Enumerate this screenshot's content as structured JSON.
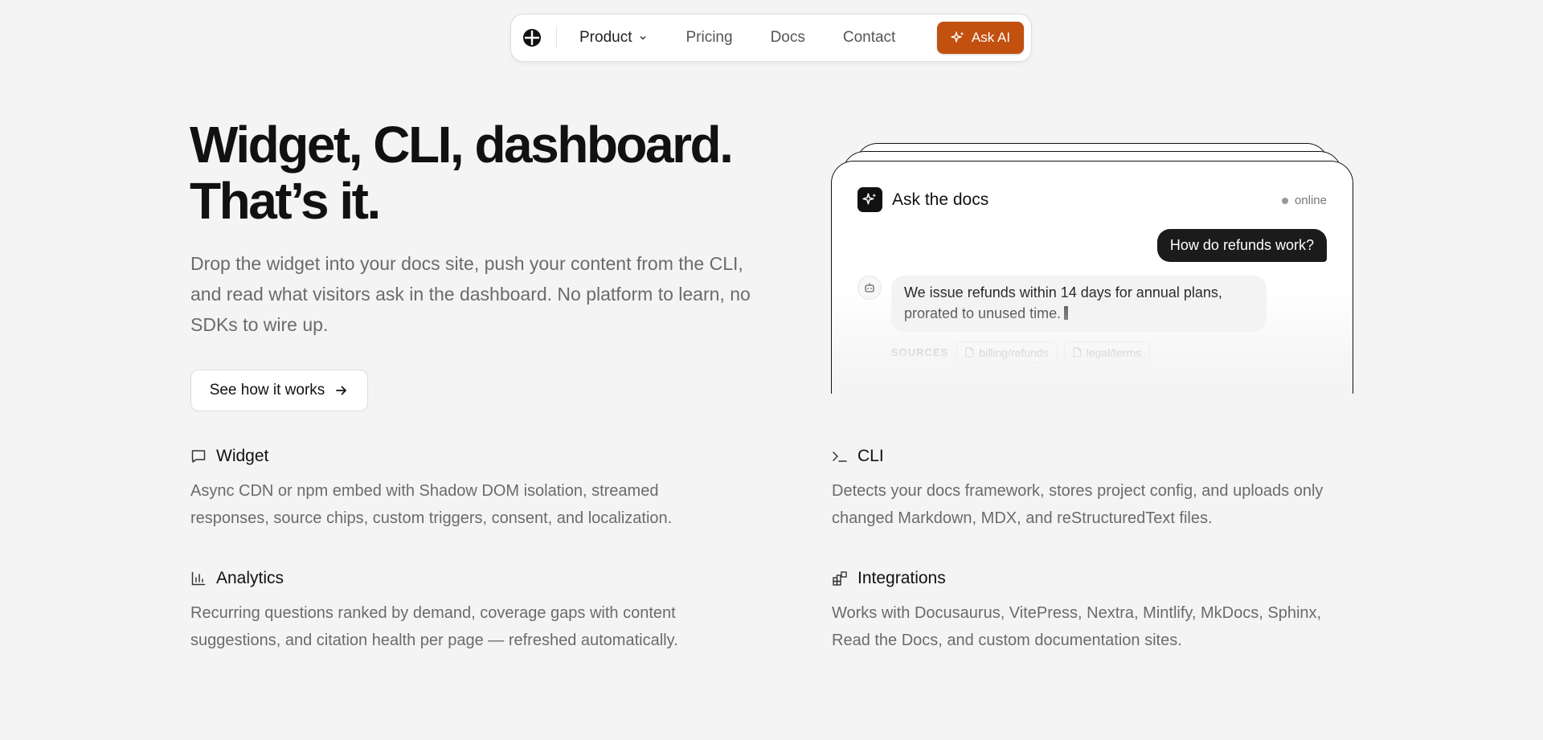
{
  "nav": {
    "items": [
      {
        "label": "Product"
      },
      {
        "label": "Pricing"
      },
      {
        "label": "Docs"
      },
      {
        "label": "Contact"
      }
    ],
    "cta_label": "Ask AI",
    "cta_color": "#c2500f"
  },
  "hero": {
    "title_line1": "Widget, CLI, dashboard.",
    "title_line2": "That’s it.",
    "description": "Drop the widget into your docs site, push your content from the CLI, and read what visitors ask in the dashboard. No platform to learn, no SDKs to wire up.",
    "cta_label": "See how it works"
  },
  "chat": {
    "title": "Ask the docs",
    "status": "online",
    "user_message": "How do refunds work?",
    "bot_message": "We issue refunds within 14 days for annual plans, prorated to unused time.",
    "sources_label": "SOURCES",
    "sources": [
      {
        "label": "billing/refunds"
      },
      {
        "label": "legal/terms"
      }
    ]
  },
  "features": [
    {
      "icon": "chat-bubble-icon",
      "title": "Widget",
      "description": "Async CDN or npm embed with Shadow DOM isolation, streamed responses, source chips, custom triggers, consent, and localization."
    },
    {
      "icon": "terminal-icon",
      "title": "CLI",
      "description": "Detects your docs framework, stores project config, and uploads only changed Markdown, MDX, and reStructuredText files."
    },
    {
      "icon": "bar-chart-icon",
      "title": "Analytics",
      "description": "Recurring questions ranked by demand, coverage gaps with content suggestions, and citation health per page — refreshed automatically."
    },
    {
      "icon": "integrations-icon",
      "title": "Integrations",
      "description": "Works with Docusaurus, VitePress, Nextra, Mintlify, MkDocs, Sphinx, Read the Docs, and custom documentation sites."
    }
  ]
}
